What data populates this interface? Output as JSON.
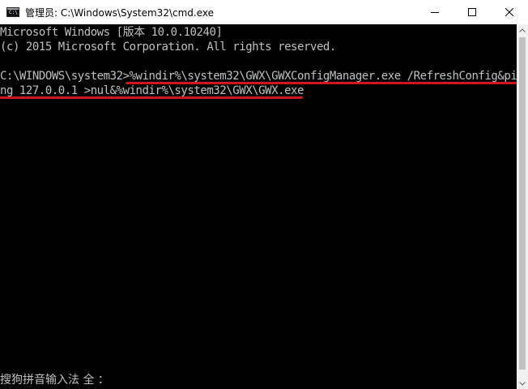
{
  "window": {
    "title": "管理员: C:\\Windows\\System32\\cmd.exe",
    "app_icon": "cmd-icon",
    "app_icon_text": "C:\\",
    "buttons": {
      "minimize": "minimize-icon",
      "maximize": "maximize-icon",
      "close": "close-icon"
    }
  },
  "console": {
    "text_color": "#c0c0c0",
    "background": "#000000",
    "lines": [
      "Microsoft Windows [版本 10.0.10240]",
      "(c) 2015 Microsoft Corporation. All rights reserved.",
      "",
      "C:\\WINDOWS\\system32>%windir%\\system32\\GWX\\GWXConfigManager.exe /RefreshConfig&pi",
      "ng 127.0.0.1 >nul&%windir%\\system32\\GWX\\GWX.exe"
    ],
    "ime_status": "搜狗拼音输入法 全 ："
  },
  "annotation": {
    "color": "#d2141c"
  }
}
